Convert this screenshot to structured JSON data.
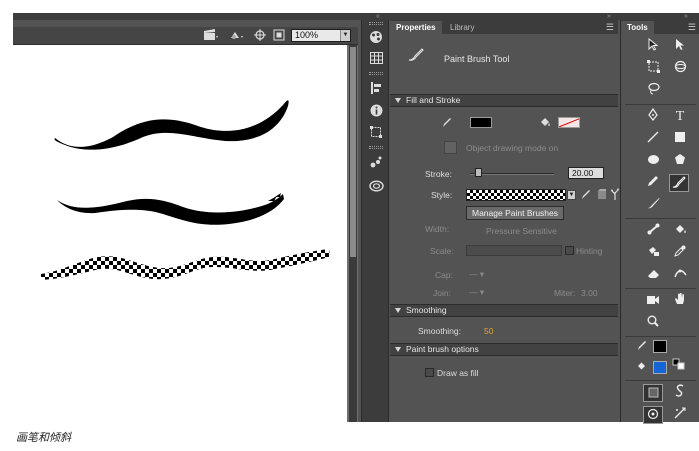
{
  "toolbar": {
    "zoom_value": "100%",
    "icons": [
      "scene-clapper-icon",
      "symbol-shape-icon",
      "center-stage-icon",
      "clip-content-icon"
    ]
  },
  "side_strip": {
    "icons": [
      "color-wheel-icon",
      "swatches-icon",
      "align-icon",
      "info-icon",
      "transform-icon",
      "components-icon",
      "creative-cloud-libraries-icon"
    ]
  },
  "properties": {
    "tab_active": "Properties",
    "tab_other": "Library",
    "tool_name": "Paint Brush Tool",
    "fill_stroke": {
      "header": "Fill and Stroke",
      "object_drawing": "Object drawing mode on",
      "stroke_label": "Stroke:",
      "stroke_value": "20.00",
      "style_label": "Style:",
      "manage_button": "Manage Paint Brushes",
      "width_label": "Width:",
      "width_value": "Pressure Sensitive",
      "scale_label": "Scale:",
      "hinting_label": "Hinting",
      "cap_label": "Cap:",
      "join_label": "Join:",
      "miter_label": "Miter:",
      "miter_value": "3.00",
      "stroke_color": "#000000"
    },
    "smoothing": {
      "header": "Smoothing",
      "label": "Smoothing:",
      "value": "50"
    },
    "brush_options": {
      "header": "Paint brush options",
      "draw_as_fill": "Draw as fill"
    }
  },
  "tools_panel": {
    "title": "Tools",
    "selected_tool": "paint-brush-tool",
    "fill_color": "#1565d6",
    "stroke_color": "#000000"
  },
  "caption": "画笔和倾斜"
}
